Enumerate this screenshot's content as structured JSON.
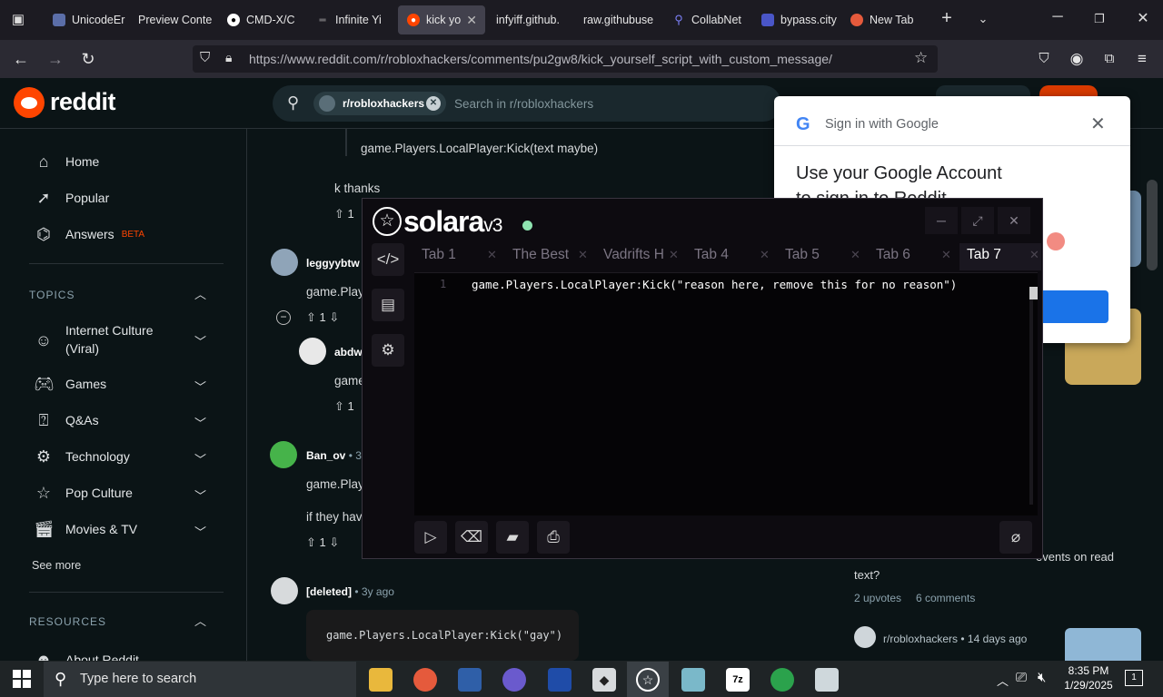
{
  "browser": {
    "tabs": [
      {
        "label": "UnicodeEr",
        "icon": "tab-favicon"
      },
      {
        "label": "Preview Conte",
        "icon": "tab-favicon"
      },
      {
        "label": "CMD-X/C",
        "icon": "github-icon"
      },
      {
        "label": "Infinite Yi",
        "icon": "tab-favicon"
      },
      {
        "label": "kick yo",
        "icon": "reddit-icon",
        "active": true
      },
      {
        "label": "infyiff.github.",
        "icon": "tab-favicon"
      },
      {
        "label": "raw.githubuse",
        "icon": "tab-favicon"
      },
      {
        "label": "CollabNet",
        "icon": "search-icon"
      },
      {
        "label": "bypass.city",
        "icon": "tab-favicon"
      },
      {
        "label": "New Tab",
        "icon": "firefox-icon"
      }
    ],
    "url": "https://www.reddit.com/r/robloxhackers/comments/pu2gw8/kick_yourself_script_with_custom_message/"
  },
  "reddit": {
    "logo_text": "reddit",
    "search_chip": "r/robloxhackers",
    "search_placeholder": "Search in r/robloxhackers",
    "nav": {
      "home": "Home",
      "popular": "Popular",
      "answers": "Answers",
      "answers_badge": "BETA"
    },
    "topics_header": "TOPICS",
    "topics": [
      {
        "label": "Internet Culture\n(Viral)"
      },
      {
        "label": "Games"
      },
      {
        "label": "Q&As"
      },
      {
        "label": "Technology"
      },
      {
        "label": "Pop Culture"
      },
      {
        "label": "Movies & TV"
      }
    ],
    "see_more": "See more",
    "resources_header": "RESOURCES",
    "about_reddit": "About Reddit"
  },
  "comments": {
    "c0_text": "game.Players.LocalPlayer:Kick(text maybe)",
    "c1_text": "k thanks",
    "c1_votes": "1",
    "c2_user": "leggyybtw",
    "c2_text": "game.Play",
    "c2_votes": "1",
    "c3_user": "abdw",
    "c3_text": "game",
    "c3_votes": "1",
    "c4_user": "Ban_ov",
    "c4_time": "• 3y",
    "c4_text": "game.Play",
    "c4_text2": "if they hav",
    "c4_votes": "1",
    "c5_user": "[deleted]",
    "c5_time": "• 3y ago",
    "c5_code": "game.Players.LocalPlayer:Kick(\"gay\")"
  },
  "right_panel": {
    "post_text_line1": "events on read",
    "post_text_line2": "text?",
    "upvotes": "2 upvotes",
    "comments": "6 comments",
    "sub_meta": "r/robloxhackers • 14 days ago"
  },
  "google_popup": {
    "title": "Sign in with Google",
    "heading": "Use your Google Account",
    "subheading": "to sign in to Reddit"
  },
  "solara": {
    "title": "solara",
    "version": "v3",
    "tabs": [
      "Tab 1",
      "The Best",
      "Vadrifts H",
      "Tab 4",
      "Tab 5",
      "Tab 6",
      "Tab 7"
    ],
    "active_tab": "Tab 7",
    "line_number": "1",
    "code": "game.Players.LocalPlayer:Kick(\"reason here, remove this for no reason\")"
  },
  "taskbar": {
    "search_placeholder": "Type here to search",
    "time": "8:35 PM",
    "date": "1/29/2025",
    "notifications": "1"
  }
}
